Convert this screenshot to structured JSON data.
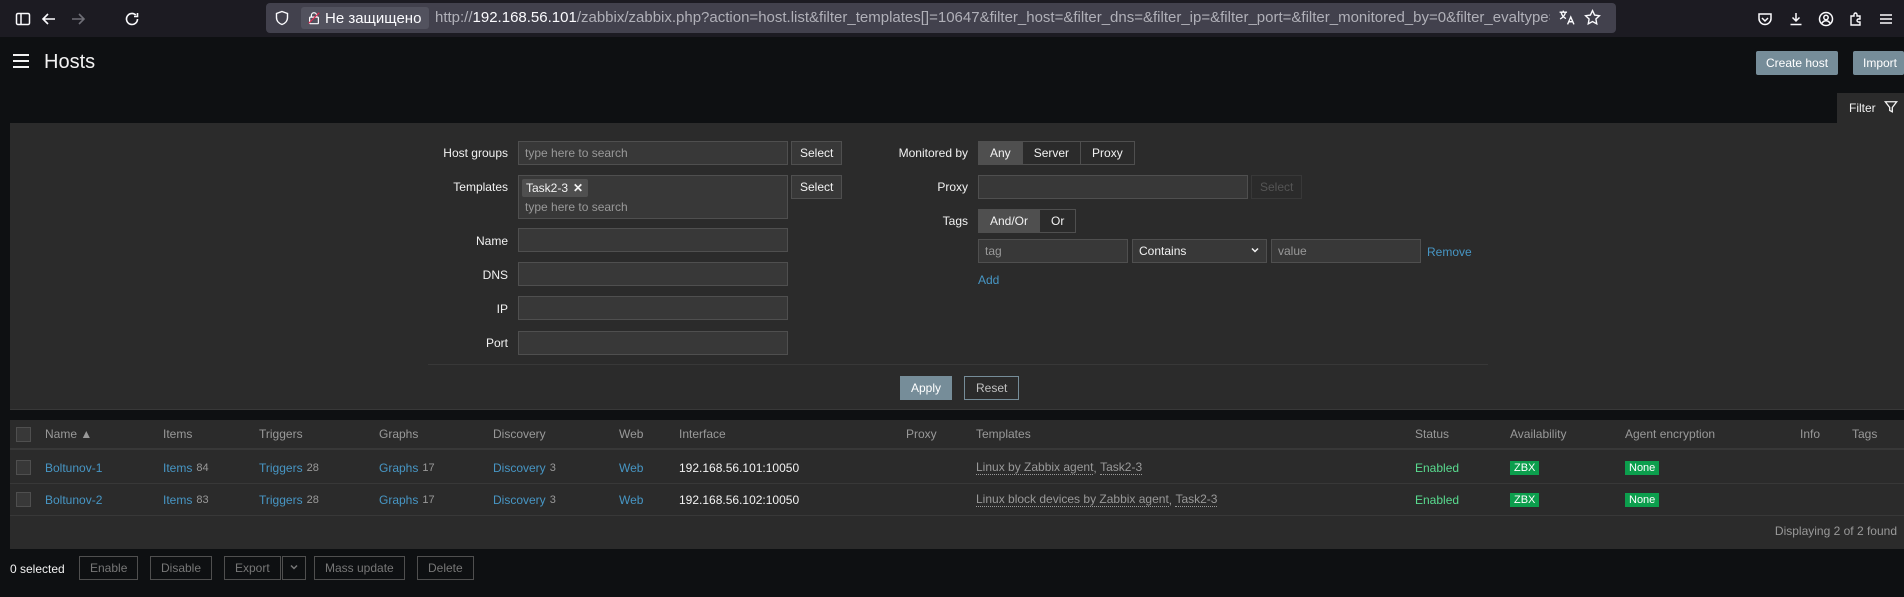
{
  "browser": {
    "insecure_label": "Не защищено",
    "url_prefix": "http://",
    "url_host": "192.168.56.101",
    "url_rest": "/zabbix/zabbix.php?action=host.list&filter_templates[]=10647&filter_host=&filter_dns=&filter_ip=&filter_port=&filter_monitored_by=0&filter_evaltype="
  },
  "header": {
    "title": "Hosts",
    "create_host": "Create host",
    "import": "Import"
  },
  "filter": {
    "tab_label": "Filter",
    "host_groups_label": "Host groups",
    "host_groups_placeholder": "type here to search",
    "select_label": "Select",
    "templates_label": "Templates",
    "templates_chip": "Task2-3",
    "templates_placeholder": "type here to search",
    "name_label": "Name",
    "dns_label": "DNS",
    "ip_label": "IP",
    "port_label": "Port",
    "monitored_by_label": "Monitored by",
    "monitored_by_options": [
      "Any",
      "Server",
      "Proxy"
    ],
    "monitored_by_selected": "Any",
    "proxy_label": "Proxy",
    "tags_label": "Tags",
    "tags_mode_options": [
      "And/Or",
      "Or"
    ],
    "tags_mode_selected": "And/Or",
    "tag_placeholder": "tag",
    "tag_operator": "Contains",
    "value_placeholder": "value",
    "remove_label": "Remove",
    "add_label": "Add",
    "apply_label": "Apply",
    "reset_label": "Reset"
  },
  "table": {
    "columns": [
      "Name ▲",
      "Items",
      "Triggers",
      "Graphs",
      "Discovery",
      "Web",
      "Interface",
      "Proxy",
      "Templates",
      "Status",
      "Availability",
      "Agent encryption",
      "Info",
      "Tags"
    ],
    "rows": [
      {
        "name": "Boltunov-1",
        "items_label": "Items",
        "items_count": "84",
        "triggers_label": "Triggers",
        "triggers_count": "28",
        "graphs_label": "Graphs",
        "graphs_count": "17",
        "discovery_label": "Discovery",
        "discovery_count": "3",
        "web": "Web",
        "interface": "192.168.56.101:10050",
        "template_1": "Linux by Zabbix agent",
        "template_2": "Task2-3",
        "status": "Enabled",
        "availability": "ZBX",
        "encryption": "None"
      },
      {
        "name": "Boltunov-2",
        "items_label": "Items",
        "items_count": "83",
        "triggers_label": "Triggers",
        "triggers_count": "28",
        "graphs_label": "Graphs",
        "graphs_count": "17",
        "discovery_label": "Discovery",
        "discovery_count": "3",
        "web": "Web",
        "interface": "192.168.56.102:10050",
        "template_1": "Linux block devices by Zabbix agent",
        "template_2": "Task2-3",
        "status": "Enabled",
        "availability": "ZBX",
        "encryption": "None"
      }
    ],
    "displaying": "Displaying 2 of 2 found"
  },
  "footer": {
    "selected": "0 selected",
    "enable": "Enable",
    "disable": "Disable",
    "export": "Export",
    "mass_update": "Mass update",
    "delete": "Delete"
  }
}
